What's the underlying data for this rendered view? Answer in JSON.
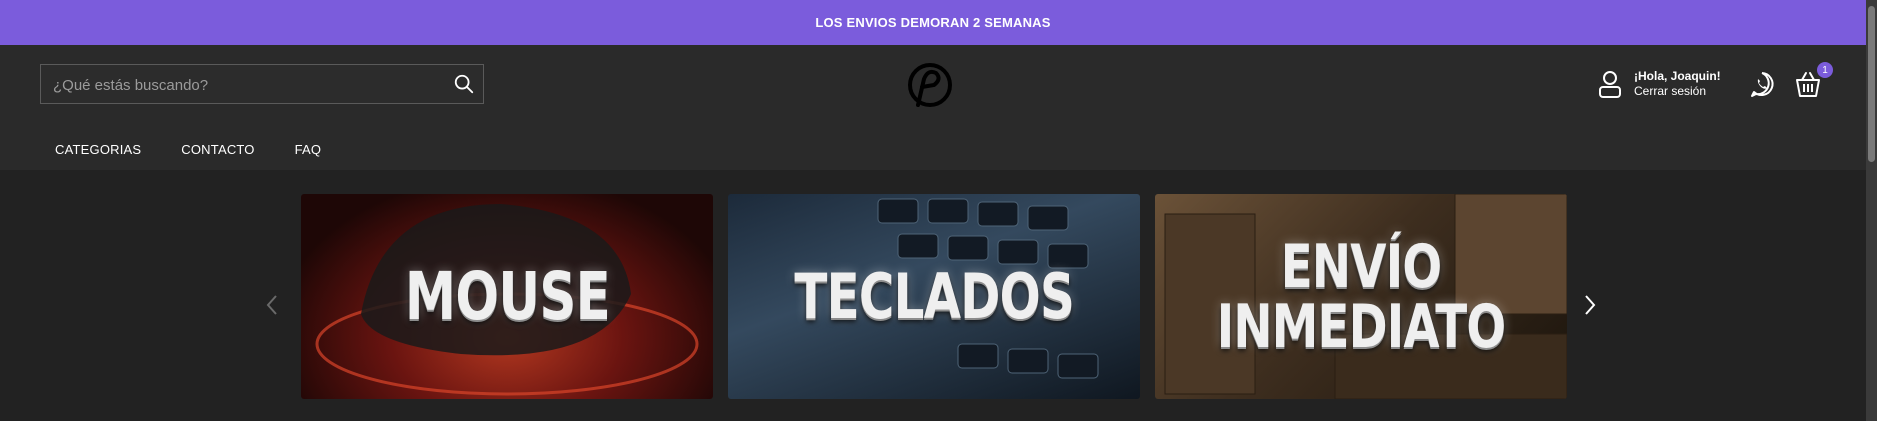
{
  "announcement": "LOS ENVIOS DEMORAN 2 SEMANAS",
  "search": {
    "placeholder": "¿Qué estás buscando?",
    "value": ""
  },
  "user": {
    "greeting": "¡Hola, Joaquin!",
    "logout": "Cerrar sesión"
  },
  "cart": {
    "count": "1"
  },
  "nav": [
    "CATEGORIAS",
    "CONTACTO",
    "FAQ"
  ],
  "slides": [
    {
      "title": "MOUSE"
    },
    {
      "title": "TECLADOS"
    },
    {
      "title_line1": "ENVÍO",
      "title_line2": "INMEDIATO"
    }
  ],
  "colors": {
    "accent": "#7b5cdc",
    "header_bg": "#2a2a2a",
    "content_bg": "#222222"
  },
  "icons": [
    "search-icon",
    "brand-logo",
    "user-icon",
    "whatsapp-icon",
    "basket-icon",
    "chevron-left-icon",
    "chevron-right-icon"
  ]
}
